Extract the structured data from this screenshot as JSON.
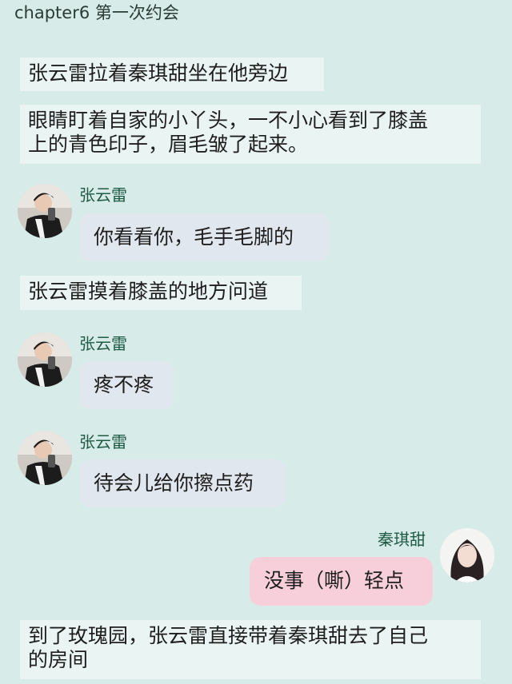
{
  "chapter": "chapter6 第一次约会",
  "narration": [
    "张云雷拉着秦琪甜坐在他旁边",
    "眼睛盯着自家的小丫头，一不小心看到了膝盖上的青色印子，眉毛皱了起来。",
    "张云雷摸着膝盖的地方问道",
    "到了玫瑰园，张云雷直接带着秦琪甜去了自己的房间"
  ],
  "narration_lines": {
    "n2_line1": "眼睛盯着自家的小丫头，一不小心看到了膝盖",
    "n2_line2": "上的青色印子，眉毛皱了起来。",
    "n4_line1": "到了玫瑰园，张云雷直接带着秦琪甜去了自己",
    "n4_line2": "的房间"
  },
  "messages": [
    {
      "speaker": "张云雷",
      "text": "你看看你，毛手毛脚的",
      "side": "left"
    },
    {
      "speaker": "张云雷",
      "text": "疼不疼",
      "side": "left"
    },
    {
      "speaker": "张云雷",
      "text": "待会儿给你擦点药",
      "side": "left"
    },
    {
      "speaker": "秦琪甜",
      "text": "没事（嘶）轻点",
      "side": "right"
    }
  ],
  "colors": {
    "background": "#d7ece8",
    "narration_bg": "#eaf5f3",
    "left_bubble": "#e1e7ee",
    "right_bubble": "#f7cfdb",
    "name_color": "#1f5a44"
  },
  "icons": [
    "avatar-male",
    "avatar-female"
  ]
}
